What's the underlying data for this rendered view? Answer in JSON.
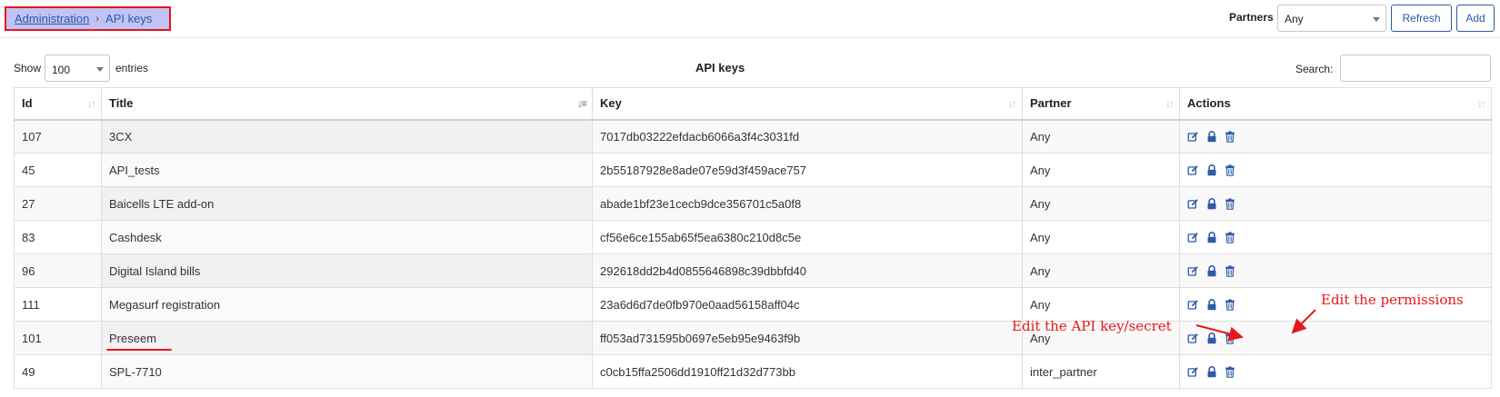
{
  "breadcrumb": {
    "parent": "Administration",
    "current": "API keys"
  },
  "header": {
    "partners_label": "Partners",
    "partners_value": "Any",
    "refresh_label": "Refresh",
    "add_label": "Add"
  },
  "controls": {
    "show_label": "Show",
    "page_length": "100",
    "entries_label": "entries",
    "caption": "API keys",
    "search_label": "Search:",
    "search_value": ""
  },
  "table": {
    "columns": [
      "Id",
      "Title",
      "Key",
      "Partner",
      "Actions"
    ],
    "sorted_column": "Title",
    "rows": [
      {
        "id": "107",
        "title": "3CX",
        "key": "7017db03222efdacb6066a3f4c3031fd",
        "partner": "Any"
      },
      {
        "id": "45",
        "title": "API_tests",
        "key": "2b55187928e8ade07e59d3f459ace757",
        "partner": "Any"
      },
      {
        "id": "27",
        "title": "Baicells LTE add-on",
        "key": "abade1bf23e1cecb9dce356701c5a0f8",
        "partner": "Any"
      },
      {
        "id": "83",
        "title": "Cashdesk",
        "key": "cf56e6ce155ab65f5ea6380c210d8c5e",
        "partner": "Any"
      },
      {
        "id": "96",
        "title": "Digital Island bills",
        "key": "292618dd2b4d0855646898c39dbbfd40",
        "partner": "Any"
      },
      {
        "id": "111",
        "title": "Megasurf registration",
        "key": "23a6d6d7de0fb970e0aad56158aff04c",
        "partner": "Any"
      },
      {
        "id": "101",
        "title": "Preseem",
        "key": "ff053ad731595b0697e5eb95e9463f9b",
        "partner": "Any"
      },
      {
        "id": "49",
        "title": "SPL-7710",
        "key": "c0cb15ffa2506dd1910ff21d32d773bb",
        "partner": "inter_partner"
      }
    ],
    "row_actions": [
      "edit-icon",
      "lock-icon",
      "trash-icon"
    ]
  },
  "annotations": {
    "edit_key": "Edit the API key/secret",
    "edit_permissions": "Edit the permissions",
    "color": "#e8161b"
  },
  "colors": {
    "accent": "#2e5aa8",
    "breadcrumb_bg": "#bfc3f5",
    "highlight_border": "#e8161b"
  }
}
